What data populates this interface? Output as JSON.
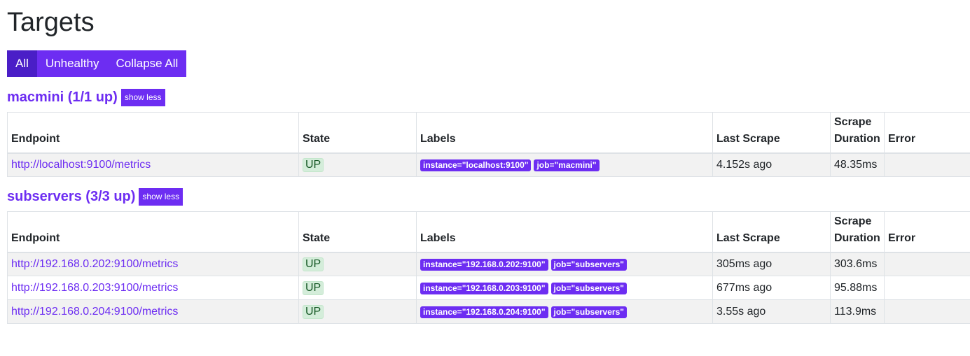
{
  "page": {
    "title": "Targets"
  },
  "filters": {
    "all": "All",
    "unhealthy": "Unhealthy",
    "collapse_all": "Collapse All"
  },
  "table_headers": {
    "endpoint": "Endpoint",
    "state": "State",
    "labels": "Labels",
    "last_scrape": "Last Scrape",
    "scrape_duration": "Scrape Duration",
    "error": "Error"
  },
  "jobs": [
    {
      "title": "macmini (1/1 up)",
      "toggle_label": "show less",
      "rows": [
        {
          "endpoint": "http://localhost:9100/metrics",
          "state": "UP",
          "labels": [
            "instance=\"localhost:9100\"",
            "job=\"macmini\""
          ],
          "last_scrape": "4.152s ago",
          "duration": "48.35ms",
          "error": ""
        }
      ]
    },
    {
      "title": "subservers (3/3 up)",
      "toggle_label": "show less",
      "rows": [
        {
          "endpoint": "http://192.168.0.202:9100/metrics",
          "state": "UP",
          "labels": [
            "instance=\"192.168.0.202:9100\"",
            "job=\"subservers\""
          ],
          "last_scrape": "305ms ago",
          "duration": "303.6ms",
          "error": ""
        },
        {
          "endpoint": "http://192.168.0.203:9100/metrics",
          "state": "UP",
          "labels": [
            "instance=\"192.168.0.203:9100\"",
            "job=\"subservers\""
          ],
          "last_scrape": "677ms ago",
          "duration": "95.88ms",
          "error": ""
        },
        {
          "endpoint": "http://192.168.0.204:9100/metrics",
          "state": "UP",
          "labels": [
            "instance=\"192.168.0.204:9100\"",
            "job=\"subservers\""
          ],
          "last_scrape": "3.55s ago",
          "duration": "113.9ms",
          "error": ""
        }
      ]
    }
  ],
  "colors": {
    "accent": "#6d2df2",
    "accent_active": "#4a1ec7",
    "up_bg": "#d4edda",
    "up_text": "#155724"
  }
}
